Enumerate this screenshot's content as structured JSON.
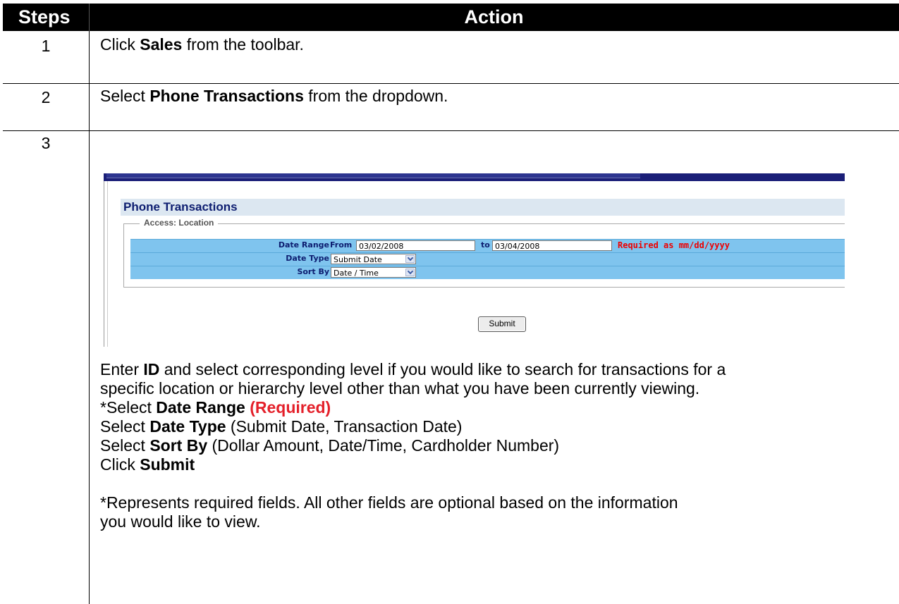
{
  "header": {
    "steps": "Steps",
    "action": "Action"
  },
  "rows": [
    {
      "num": "1",
      "pre": "Click ",
      "bold": "Sales",
      "post": " from the toolbar."
    },
    {
      "num": "2",
      "pre": "Select ",
      "bold": "Phone Transactions",
      "post": " from the dropdown."
    },
    {
      "num": "3"
    }
  ],
  "screenshot": {
    "title": "Phone Transactions",
    "legend": "Access: Location",
    "date_range_label": "Date Range",
    "from_label": "From",
    "from_value": "03/02/2008",
    "to_label": "to",
    "to_value": "03/04/2008",
    "required_note": "Required as mm/dd/yyyy",
    "date_type_label": "Date Type",
    "date_type_value": "Submit Date",
    "sort_by_label": "Sort By",
    "sort_by_value": "Date / Time",
    "submit": "Submit"
  },
  "desc": {
    "l1_pre": "Enter ",
    "l1_bold": "ID",
    "l1_post": " and select corresponding level if you would like to search for transactions for a",
    "l2": "specific location or hierarchy level other than what you have been currently viewing.",
    "l3_pre": "*Select ",
    "l3_bold": "Date Range ",
    "l3_red": "(Required)",
    "l4_pre": "Select ",
    "l4_bold": "Date Type",
    "l4_post": " (Submit Date, Transaction Date)",
    "l5_pre": "Select ",
    "l5_bold": "Sort By",
    "l5_post": " (Dollar Amount, Date/Time, Cardholder Number)",
    "l6_pre": "Click ",
    "l6_bold": "Submit",
    "l7": "*Represents required fields. All other fields are optional based on the information",
    "l8": "you would like to view."
  }
}
